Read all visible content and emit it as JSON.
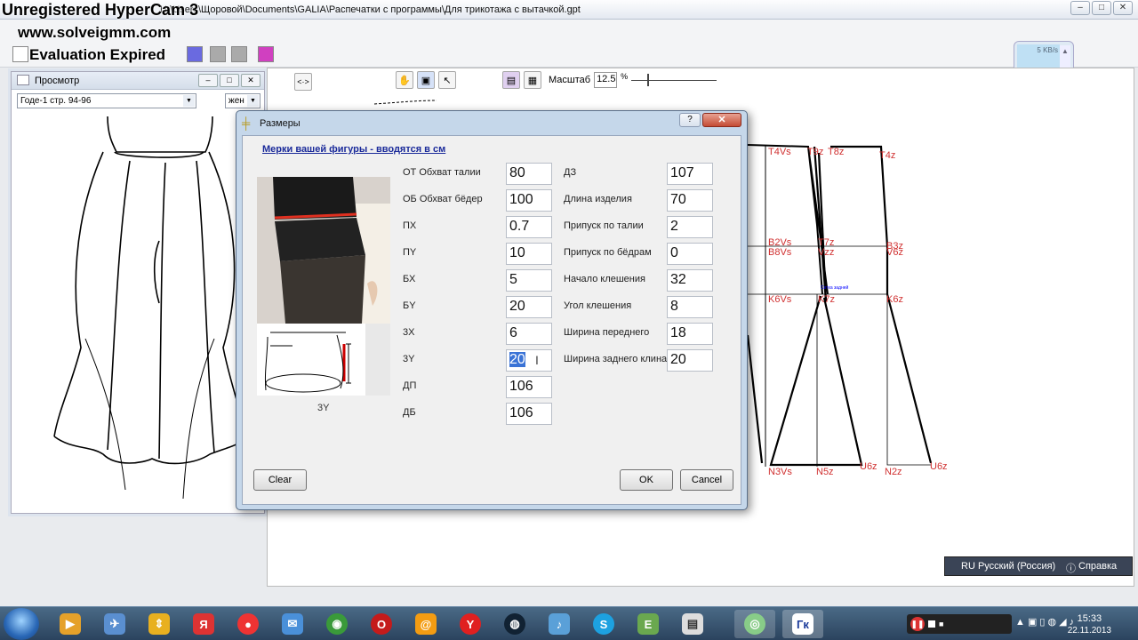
{
  "window": {
    "title": "Ц:\\Users\\Щоровой\\Documents\\GALIA\\Распечатки с программы\\Для трикотажа  с вытачкой.gpt"
  },
  "watermark": {
    "line1": "Unregistered HyperCam 3",
    "line2": "www.solveigmm.com",
    "line3": "Evaluation Expired"
  },
  "toolbar": {
    "scale_label": "Масштаб",
    "scale_value": "12.5",
    "scale_unit": "%",
    "nav_label": "<·>"
  },
  "network_widget": {
    "speed": "5 KB/s"
  },
  "preview": {
    "title": "Просмотр",
    "model_select": "Годе-1 стр. 94-96",
    "gender_select": "жен"
  },
  "dialog": {
    "title": "Размеры",
    "help_btn": "?",
    "close_btn": "✕",
    "heading": "Мерки вашей фигуры - вводятся в см",
    "photo_caption": "3Y",
    "left_fields": [
      {
        "label": "ОТ Обхват талии",
        "value": "80"
      },
      {
        "label": "ОБ Обхват бёдер",
        "value": "100"
      },
      {
        "label": "ПХ",
        "value": "0.7"
      },
      {
        "label": "ПY",
        "value": "10"
      },
      {
        "label": "БХ",
        "value": "5"
      },
      {
        "label": "БY",
        "value": "20"
      },
      {
        "label": "3Х",
        "value": "6"
      },
      {
        "label": "3Y",
        "value": "20"
      },
      {
        "label": "ДП",
        "value": "106"
      },
      {
        "label": "ДБ",
        "value": "106"
      }
    ],
    "right_fields": [
      {
        "label": "ДЗ",
        "value": "107"
      },
      {
        "label": "Длина изделия",
        "value": "70"
      },
      {
        "label": "Припуск по талии",
        "value": "2"
      },
      {
        "label": "Припуск по бёдрам",
        "value": "0"
      },
      {
        "label": "Начало клешения",
        "value": "32"
      },
      {
        "label": "Угол клешения",
        "value": "8"
      },
      {
        "label": "Ширина переднего",
        "value": "18"
      },
      {
        "label": "Ширина заднего клина",
        "value": "20"
      }
    ],
    "clear_btn": "Clear",
    "ok_btn": "OK",
    "cancel_btn": "Cancel"
  },
  "pattern_labels": {
    "a": "T4Vs",
    "b": "T9z",
    "c": "T8z",
    "d": "T4z",
    "e": "B2Vs",
    "f": "B8Vs",
    "g": "T7z",
    "h": "Vzz",
    "i": "B3z",
    "j": "V6z",
    "k": "K6Vs",
    "l": "K7z",
    "m": "K6z",
    "n": "N3Vs",
    "o": "N5z",
    "p": "U6z",
    "q": "N2z",
    "r": "U6z",
    "tiny": "Сетка задней"
  },
  "language_bar": {
    "lang": "RU Русский (Россия)",
    "help": "Справка"
  },
  "taskbar": {
    "time": "15:33",
    "date": "22.11.2013",
    "gk_label": "Гк"
  }
}
